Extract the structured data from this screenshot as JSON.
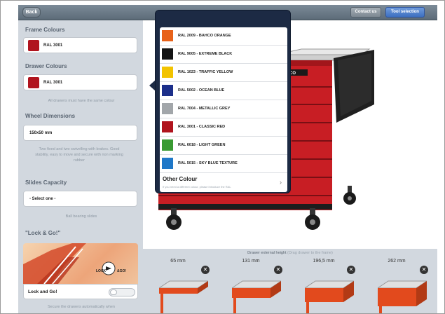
{
  "header": {
    "back_label": "Back",
    "contact_label": "Contact us",
    "tool_label": "Tool selection"
  },
  "sidebar": {
    "frame": {
      "title": "Frame Colours",
      "value": "RAL 3001",
      "swatch": "#b0141e"
    },
    "drawer": {
      "title": "Drawer Colours",
      "value": "RAL 3001",
      "swatch": "#b0141e",
      "note": "All drawers must have the same colour"
    },
    "wheel": {
      "title": "Wheel Dimensions",
      "value": "150x50 mm",
      "note": "Two fixed and two swivelling with brakes. Good stability, easy to move and secure with non marking rubber"
    },
    "slides": {
      "title": "Slides Capacity",
      "value": "- Select one -",
      "note": "Ball bearing slides"
    },
    "lock": {
      "title": "\"Lock & Go!\"",
      "image_text_lock": "LOCK",
      "image_text_go": "&GO!",
      "row_label": "Lock and Go!",
      "note": "Secure the drawers automatically when"
    }
  },
  "popover": {
    "options": [
      {
        "label": "RAL 2009 - BAHCO ORANGE",
        "color": "#e8621a"
      },
      {
        "label": "RAL 9005 - EXTREME BLACK",
        "color": "#141414"
      },
      {
        "label": "RAL 1023 - TRAFFIC YELLOW",
        "color": "#f2c300"
      },
      {
        "label": "RAL 5002 - OCEAN BLUE",
        "color": "#1c2f8a"
      },
      {
        "label": "RAL 7004 - METALLIC GREY",
        "color": "#a2a6aa"
      },
      {
        "label": "RAL 3001 - CLASSIC RED",
        "color": "#b0141e"
      },
      {
        "label": "RAL 6018 - LIGHT GREEN",
        "color": "#3a9a33"
      },
      {
        "label": "RAL 5015 - SKY BLUE TEXTURE",
        "color": "#1f78c8"
      }
    ],
    "other_title": "Other Colour",
    "other_subtitle": "If you need a different colour, please introduce the RAL"
  },
  "cabinet": {
    "badge": "BAHCO"
  },
  "bottom": {
    "hint_main": "Drawer external height",
    "hint_dim": "(Drag drawer to the frame)",
    "drawers": [
      {
        "label": "65 mm"
      },
      {
        "label": "131 mm"
      },
      {
        "label": "196,5 mm"
      },
      {
        "label": "262 mm"
      }
    ]
  },
  "colors": {
    "accent_red": "#c81e24",
    "sidebar_bg": "#d2d8df",
    "popover_bg": "#1c2a44"
  }
}
